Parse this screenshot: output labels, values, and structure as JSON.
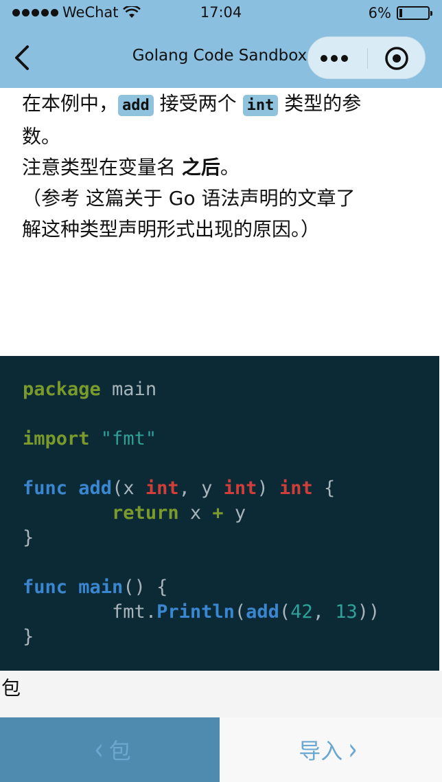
{
  "status": {
    "carrier": "WeChat",
    "time": "17:04",
    "battery": "6%"
  },
  "nav": {
    "title": "Golang Code Sandbox",
    "back_icon": "chevron-left-icon",
    "more_icon": "more-dots-icon",
    "close_icon": "target-close-icon"
  },
  "content": {
    "line1_a": "在本例中，",
    "line1_code1": "add",
    "line1_b": " 接受两个 ",
    "line1_code2": "int",
    "line1_c": " 类型的参",
    "line2": "数。",
    "line3_a": "注意类型在变量名 ",
    "line3_bold": "之后",
    "line3_b": "。",
    "line4": "（参考 这篇关于 Go 语法声明的文章了",
    "line5": "解这种类型声明形式出现的原因。）"
  },
  "code": {
    "l1_kw": "package",
    "l1_rest": " main",
    "l3_kw": "import",
    "l3_str": " \"fmt\"",
    "l5_func": "func",
    "l5_name": " add",
    "l5_p1": "(x ",
    "l5_t1": "int",
    "l5_p2": ", y ",
    "l5_t2": "int",
    "l5_p3": ") ",
    "l5_t3": "int",
    "l5_p4": " {",
    "l6_indent": "        ",
    "l6_kw": "return",
    "l6_a": " x ",
    "l6_op": "+",
    "l6_b": " y",
    "l7": "}",
    "l9_func": "func",
    "l9_name": " main",
    "l9_rest": "() {",
    "l10_indent": "        ",
    "l10_obj": "fmt.",
    "l10_fn": "Println",
    "l10_p1": "(",
    "l10_add": "add",
    "l10_p2": "(",
    "l10_n1": "42",
    "l10_p3": ", ",
    "l10_n2": "13",
    "l10_p4": "))",
    "l11": "}"
  },
  "package_label": "包",
  "bottom": {
    "prev_label": "包",
    "next_label": "导入"
  },
  "colors": {
    "header_bg": "#8bbfdf",
    "code_bg": "#0c2a36",
    "prev_btn_bg": "#4f8bae"
  }
}
